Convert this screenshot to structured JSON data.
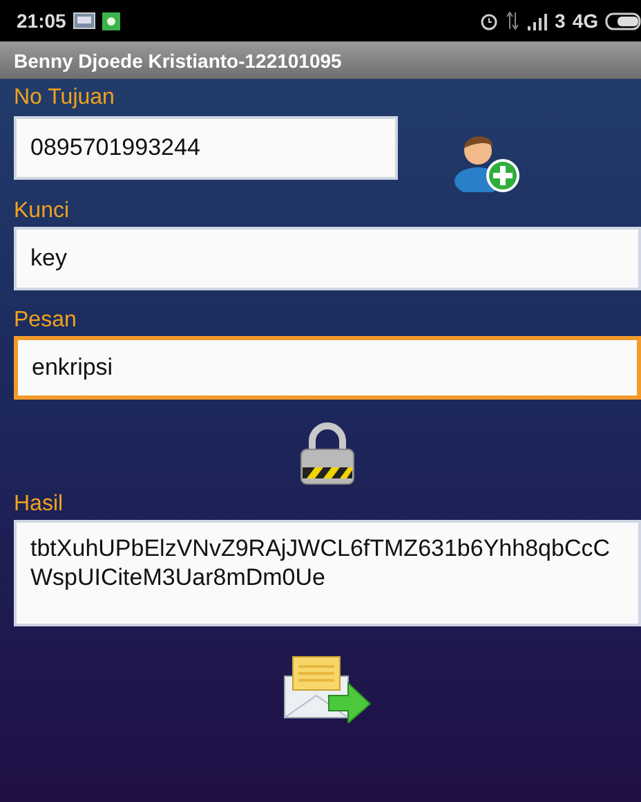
{
  "status_bar": {
    "time": "21:05",
    "sim": "3",
    "network": "4G"
  },
  "app_bar": {
    "title": "Benny Djoede Kristianto-122101095"
  },
  "fields": [
    {
      "label": "No Tujuan",
      "value": "0895701993244",
      "focused": false,
      "kind": "phone"
    },
    {
      "label": "Kunci",
      "value": "key",
      "focused": false,
      "kind": "text"
    },
    {
      "label": "Pesan",
      "value": "enkripsi",
      "focused": true,
      "kind": "text"
    },
    {
      "label": "Hasil",
      "value": "tbtXuhUPbElzVNvZ9RAjJWCL6fTMZ631b6Yhh8qbCcCWspUICiteM3Uar8mDm0Ue",
      "focused": false,
      "kind": "result"
    }
  ]
}
